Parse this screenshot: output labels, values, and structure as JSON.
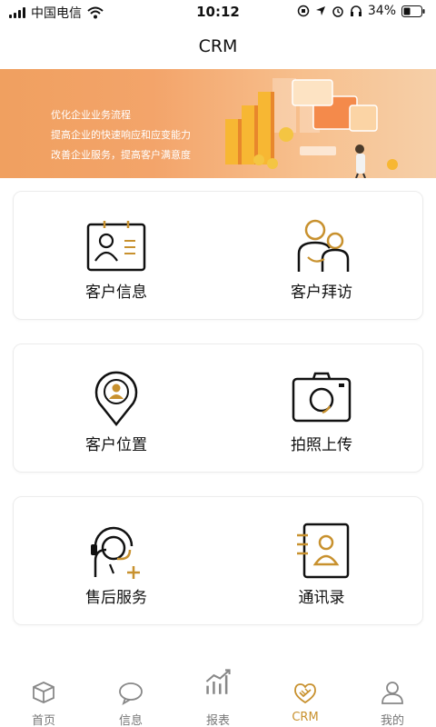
{
  "status_bar": {
    "carrier": "中国电信",
    "time": "10:12",
    "battery": "34%"
  },
  "header": {
    "title": "CRM"
  },
  "banner": {
    "lines": [
      "优化企业业务流程",
      "提高企业的快速响应和应变能力",
      "改善企业服务，提高客户满意度"
    ]
  },
  "features": [
    {
      "label": "客户信息",
      "icon": "customer-info-icon"
    },
    {
      "label": "客户拜访",
      "icon": "customer-visit-icon"
    },
    {
      "label": "客户位置",
      "icon": "customer-location-icon"
    },
    {
      "label": "拍照上传",
      "icon": "camera-icon"
    },
    {
      "label": "售后服务",
      "icon": "after-sales-icon"
    },
    {
      "label": "通讯录",
      "icon": "contacts-icon"
    }
  ],
  "tabs": [
    {
      "label": "首页",
      "icon": "cube-icon",
      "active": false
    },
    {
      "label": "信息",
      "icon": "chat-bubble-icon",
      "active": false
    },
    {
      "label": "报表",
      "icon": "report-chart-icon",
      "active": false
    },
    {
      "label": "CRM",
      "icon": "handshake-icon",
      "active": true
    },
    {
      "label": "我的",
      "icon": "person-icon",
      "active": false
    }
  ],
  "colors": {
    "accent": "#c8912e",
    "icon_gold": "#c8912e",
    "banner_start": "#f0a060",
    "banner_end": "#f6cfa8"
  }
}
